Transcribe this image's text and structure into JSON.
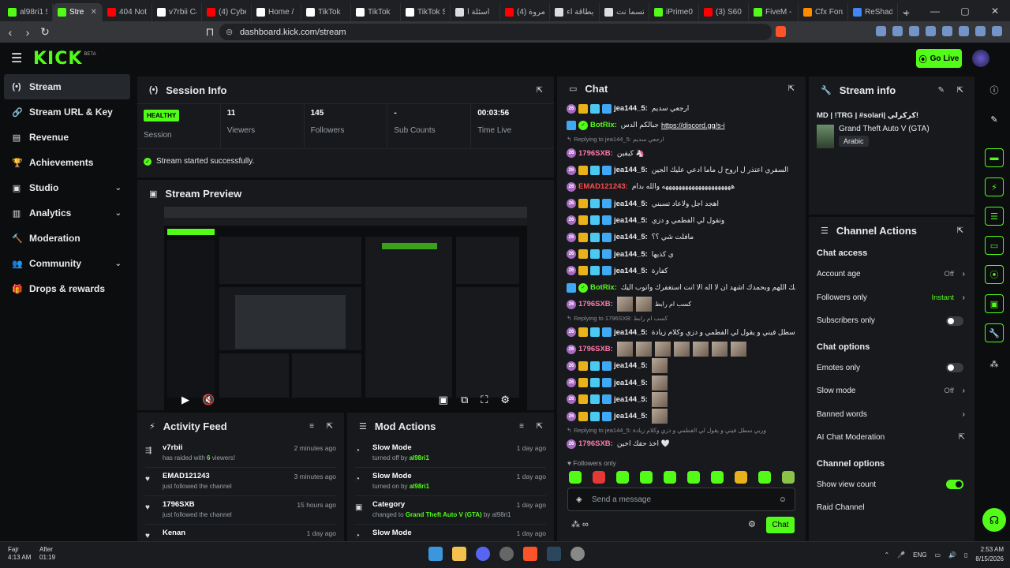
{
  "browser": {
    "tabs": [
      {
        "label": "al98ri1 5",
        "color": "#53fc18"
      },
      {
        "label": "Stre",
        "color": "#53fc18",
        "active": true
      },
      {
        "label": "404 Not",
        "color": "#ff0000"
      },
      {
        "label": "v7rbii Ca",
        "color": "#ffffff"
      },
      {
        "label": "(4) Cybe",
        "color": "#ff0000"
      },
      {
        "label": "Home /",
        "color": "#ffffff"
      },
      {
        "label": "TikTok",
        "color": "#ffffff"
      },
      {
        "label": "TikTok",
        "color": "#ffffff"
      },
      {
        "label": "TikTok S",
        "color": "#ffffff"
      },
      {
        "label": "أسئلة أ",
        "color": "#dddddd"
      },
      {
        "label": "(4) مروة",
        "color": "#ff0000"
      },
      {
        "label": "بطاقة اء",
        "color": "#dddddd"
      },
      {
        "label": "تسما نت",
        "color": "#dddddd"
      },
      {
        "label": "iPrime0",
        "color": "#53fc18"
      },
      {
        "label": "(3) S60",
        "color": "#ff0000"
      },
      {
        "label": "FiveM -",
        "color": "#53fc18"
      },
      {
        "label": "Cfx Foru",
        "color": "#ff8c00"
      },
      {
        "label": "ReShade",
        "color": "#4285f4"
      }
    ],
    "url": "dashboard.kick.com/stream"
  },
  "topnav": {
    "logo": "KICK",
    "beta": "BETA",
    "golive": "Go Live"
  },
  "sidebar": {
    "items": [
      {
        "label": "Stream",
        "icon": "(•)"
      },
      {
        "label": "Stream URL & Key",
        "icon": "🔗"
      },
      {
        "label": "Revenue",
        "icon": "▤"
      },
      {
        "label": "Achievements",
        "icon": "🏆"
      },
      {
        "label": "Studio",
        "icon": "▣"
      },
      {
        "label": "Analytics",
        "icon": "▥"
      },
      {
        "label": "Moderation",
        "icon": "🔨"
      },
      {
        "label": "Community",
        "icon": "👥"
      },
      {
        "label": "Drops & rewards",
        "icon": "🎁"
      }
    ]
  },
  "session": {
    "title": "Session Info",
    "status": "HEALTHY",
    "status_label": "Session",
    "viewers_value": "11",
    "viewers_label": "Viewers",
    "followers_value": "145",
    "followers_label": "Followers",
    "subs_value": "-",
    "subs_label": "Sub Counts",
    "time_value": "00:03:56",
    "time_label": "Time Live",
    "started": "Stream started successfully."
  },
  "preview": {
    "title": "Stream Preview"
  },
  "activity": {
    "title": "Activity Feed",
    "items": [
      {
        "name": "v7rbii",
        "sub_pre": "has raided with ",
        "sub_hl": "6",
        "sub_post": " viewers!",
        "time": "2 minutes ago"
      },
      {
        "name": "EMAD121243",
        "sub_pre": "just followed the channel",
        "sub_hl": "",
        "sub_post": "",
        "time": "3 minutes ago"
      },
      {
        "name": "1796SXB",
        "sub_pre": "just followed the channel",
        "sub_hl": "",
        "sub_post": "",
        "time": "15 hours ago"
      },
      {
        "name": "Kenan",
        "sub_pre": "",
        "sub_hl": "",
        "sub_post": "",
        "time": "1 day ago"
      }
    ]
  },
  "modactions": {
    "title": "Mod Actions",
    "items": [
      {
        "name": "Slow Mode",
        "sub_pre": "turned off by ",
        "sub_hl": "al98ri1",
        "sub_post": "",
        "time": "1 day ago"
      },
      {
        "name": "Slow Mode",
        "sub_pre": "turned on by ",
        "sub_hl": "al98ri1",
        "sub_post": "",
        "time": "1 day ago"
      },
      {
        "name": "Category",
        "sub_pre": "changed to ",
        "sub_hl": "Grand Theft Auto V (GTA)",
        "sub_post": " by al98ri1",
        "time": "1 day ago"
      },
      {
        "name": "Slow Mode",
        "sub_pre": "",
        "sub_hl": "",
        "sub_post": "",
        "time": "1 day ago"
      }
    ]
  },
  "chat": {
    "title": "Chat",
    "messages": [
      {
        "type": "msg",
        "user": "jea144_5:",
        "color": "#e8eaed",
        "badges": 4,
        "text": "ارجعي سديم"
      },
      {
        "type": "msg",
        "user": "BotRix:",
        "color": "#53fc18",
        "badges": 2,
        "text": "جبالكم الدس ",
        "link": "https://discord.gg/s-i"
      },
      {
        "type": "reply",
        "text": "Replying to jea144_5: ارجعي سديم"
      },
      {
        "type": "msg",
        "user": "1796SXB:",
        "color": "#ff7bac",
        "badges": 1,
        "text": "كيفين 🦄"
      },
      {
        "type": "msg",
        "user": "jea144_5:",
        "color": "#e8eaed",
        "badges": 4,
        "text": "السفري اعتذر ل اروح ل ماما ادعي عليك الجين"
      },
      {
        "type": "msg",
        "user": "EMAD121243:",
        "color": "#ff4d4d",
        "badges": 1,
        "text": "هههههههههههههههههههههه والله بدام"
      },
      {
        "type": "msg",
        "user": "jea144_5:",
        "color": "#e8eaed",
        "badges": 4,
        "text": "اهجد اجل ولاعاد تسبني"
      },
      {
        "type": "msg",
        "user": "jea144_5:",
        "color": "#e8eaed",
        "badges": 4,
        "text": "وتقول لي الفطمي و دزي"
      },
      {
        "type": "msg",
        "user": "jea144_5:",
        "color": "#e8eaed",
        "badges": 4,
        "text": "مافلت شي ؟؟"
      },
      {
        "type": "msg",
        "user": "jea144_5:",
        "color": "#e8eaed",
        "badges": 4,
        "text": "ي كذيها"
      },
      {
        "type": "msg",
        "user": "jea144_5:",
        "color": "#e8eaed",
        "badges": 4,
        "text": "كفارة"
      },
      {
        "type": "msg",
        "user": "BotRix:",
        "color": "#53fc18",
        "badges": 2,
        "text": "سبحانك اللهم وبحمدك اشهد ان لا اله الا انت استغفرك واتوب اليك"
      },
      {
        "type": "msg",
        "user": "1796SXB:",
        "color": "#ff7bac",
        "badges": 1,
        "text": "",
        "emotes": 2,
        "tail": "كسب ام رابط"
      },
      {
        "type": "reply",
        "text": "Replying to 1796SXB: كسب ام رابط"
      },
      {
        "type": "msg",
        "user": "jea144_5:",
        "color": "#e8eaed",
        "badges": 4,
        "text": "وربي سطل فيني و يقول لي الفطمي و دزي وكلام زيادة"
      },
      {
        "type": "msg",
        "user": "1796SXB:",
        "color": "#ff7bac",
        "badges": 1,
        "text": "",
        "emotes": 7
      },
      {
        "type": "msg",
        "user": "jea144_5:",
        "color": "#e8eaed",
        "badges": 4,
        "text": "",
        "emotes": 1
      },
      {
        "type": "msg",
        "user": "jea144_5:",
        "color": "#e8eaed",
        "badges": 4,
        "text": "",
        "emotes": 1
      },
      {
        "type": "msg",
        "user": "jea144_5:",
        "color": "#e8eaed",
        "badges": 4,
        "text": "",
        "emotes": 1
      },
      {
        "type": "msg",
        "user": "jea144_5:",
        "color": "#e8eaed",
        "badges": 4,
        "text": "",
        "emotes": 1
      },
      {
        "type": "reply",
        "text": "Replying to jea144_5: وربي سطل فيني و يقول لي الفطمي و دزي وكلام زيادة"
      },
      {
        "type": "msg",
        "user": "1796SXB:",
        "color": "#ff7bac",
        "badges": 1,
        "text": "اخذ حقك اخين 🤍"
      }
    ],
    "followers_only": "Followers only",
    "placeholder": "Send a message",
    "send": "Chat"
  },
  "streaminfo": {
    "title": "Stream info",
    "stream_title": "MD | !TRG | #solari| كركرلي!",
    "category": "Grand Theft Auto V (GTA)",
    "language": "Arabic"
  },
  "channelactions": {
    "title": "Channel Actions",
    "chat_access": "Chat access",
    "account_age": "Account age",
    "account_age_val": "Off",
    "followers_only": "Followers only",
    "followers_only_val": "Instant",
    "subscribers_only": "Subscribers only",
    "chat_options": "Chat options",
    "emotes_only": "Emotes only",
    "slow_mode": "Slow mode",
    "slow_mode_val": "Off",
    "banned_words": "Banned words",
    "ai_mod": "AI Chat Moderation",
    "channel_options": "Channel options",
    "show_view_count": "Show view count",
    "raid_channel": "Raid Channel"
  },
  "taskbar": {
    "weather_a": "Fajr",
    "weather_a2": "4:13 AM",
    "weather_b": "After",
    "weather_b2": "01:19",
    "lang": "ENG",
    "time": "2:53 AM",
    "date": "8/15/2026"
  }
}
